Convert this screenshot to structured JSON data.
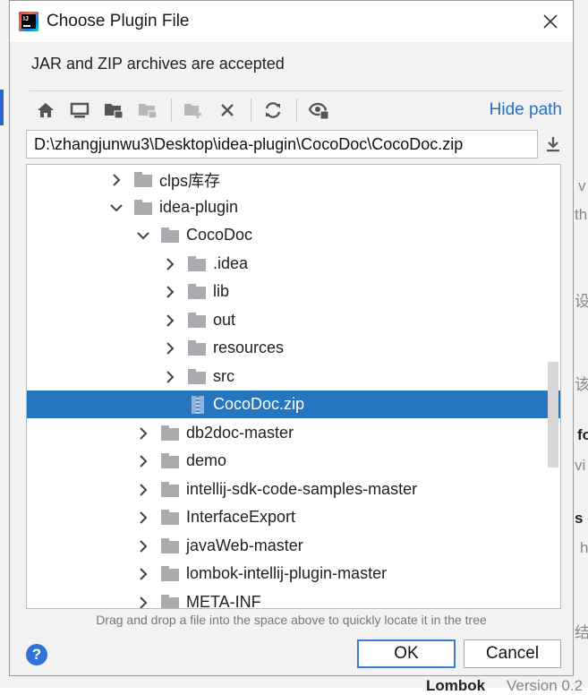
{
  "background": {
    "fragments": [
      "v",
      "th",
      "设",
      "该",
      "fo",
      "vi",
      "s o",
      "h",
      "结",
      "Lombok",
      "Version 0.2"
    ]
  },
  "dialog": {
    "title": "Choose Plugin File",
    "close_icon": "close-icon",
    "description": "JAR and ZIP archives are accepted",
    "toolbar": {
      "buttons": [
        {
          "icon": "home-icon"
        },
        {
          "icon": "desktop-icon"
        },
        {
          "icon": "project-folder-icon"
        },
        {
          "icon": "module-folder-icon"
        },
        {
          "icon": "new-folder-icon"
        },
        {
          "icon": "delete-icon"
        },
        {
          "icon": "refresh-icon"
        },
        {
          "icon": "show-hidden-icon"
        }
      ],
      "hide_path_label": "Hide path"
    },
    "path": "D:\\zhangjunwu3\\Desktop\\idea-plugin\\CocoDoc\\CocoDoc.zip",
    "tree": {
      "rows": [
        {
          "label": "clps库存",
          "expanded": false,
          "type": "folder"
        },
        {
          "label": "idea-plugin",
          "expanded": true,
          "type": "folder"
        },
        {
          "label": "CocoDoc",
          "expanded": true,
          "type": "folder"
        },
        {
          "label": ".idea",
          "expanded": false,
          "type": "folder"
        },
        {
          "label": "lib",
          "expanded": false,
          "type": "folder"
        },
        {
          "label": "out",
          "expanded": false,
          "type": "folder"
        },
        {
          "label": "resources",
          "expanded": false,
          "type": "folder"
        },
        {
          "label": "src",
          "expanded": false,
          "type": "folder"
        },
        {
          "label": "CocoDoc.zip",
          "expanded": null,
          "type": "zip",
          "selected": true
        },
        {
          "label": "db2doc-master",
          "expanded": false,
          "type": "folder"
        },
        {
          "label": "demo",
          "expanded": false,
          "type": "folder"
        },
        {
          "label": "intellij-sdk-code-samples-master",
          "expanded": false,
          "type": "folder"
        },
        {
          "label": "InterfaceExport",
          "expanded": false,
          "type": "folder"
        },
        {
          "label": "javaWeb-master",
          "expanded": false,
          "type": "folder"
        },
        {
          "label": "lombok-intellij-plugin-master",
          "expanded": false,
          "type": "folder"
        },
        {
          "label": "META-INF",
          "expanded": false,
          "type": "folder"
        }
      ]
    },
    "hint": "Drag and drop a file into the space above to quickly locate it in the tree",
    "help_label": "?",
    "ok_label": "OK",
    "cancel_label": "Cancel",
    "colors": {
      "accent": "#2675bf",
      "link": "#2470c9",
      "folder": "#a9abaf"
    }
  }
}
